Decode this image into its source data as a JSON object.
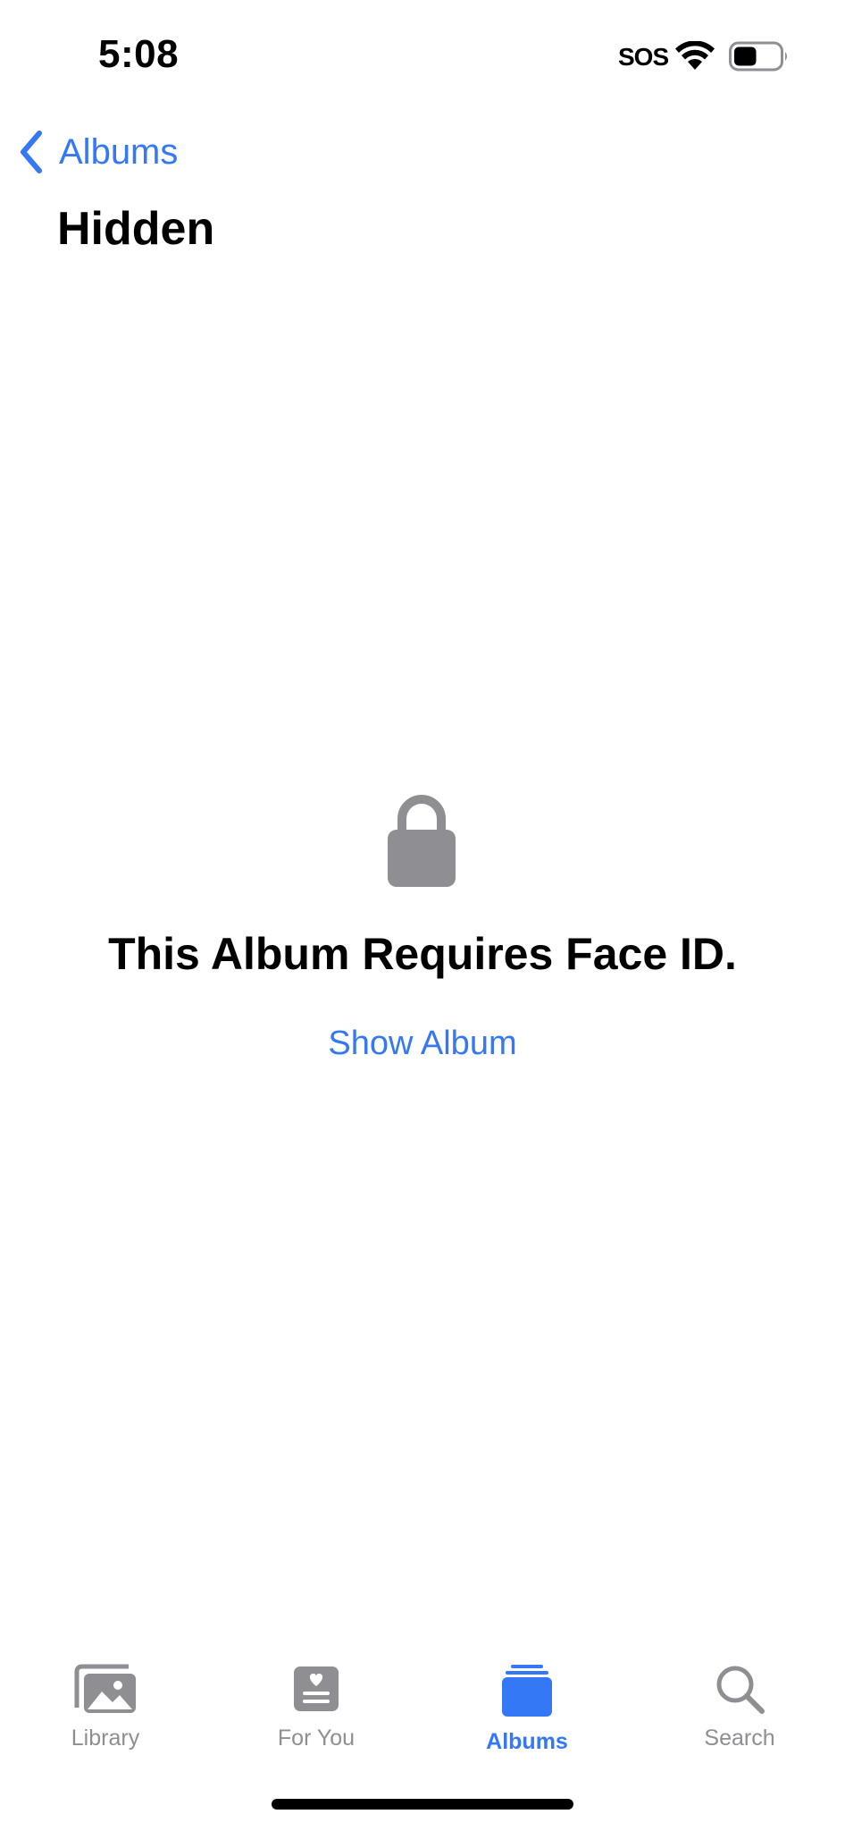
{
  "status_bar": {
    "time": "5:08",
    "carrier": "SOS",
    "wifi_icon": "wifi-icon",
    "battery_icon": "battery-icon",
    "battery_level": 0.5
  },
  "nav": {
    "back_label": "Albums",
    "back_icon": "chevron-left-icon",
    "title": "Hidden"
  },
  "locked": {
    "icon": "lock-icon",
    "message": "This Album Requires Face ID.",
    "action_label": "Show Album"
  },
  "tab_bar": {
    "tabs": [
      {
        "label": "Library",
        "icon": "photo-stack-icon",
        "active": false
      },
      {
        "label": "For You",
        "icon": "for-you-icon",
        "active": false
      },
      {
        "label": "Albums",
        "icon": "albums-icon",
        "active": true
      },
      {
        "label": "Search",
        "icon": "search-icon",
        "active": false
      }
    ]
  },
  "colors": {
    "accent": "#3478f6",
    "inactive": "#8e8e93",
    "icon_gray": "#8e8e93"
  }
}
